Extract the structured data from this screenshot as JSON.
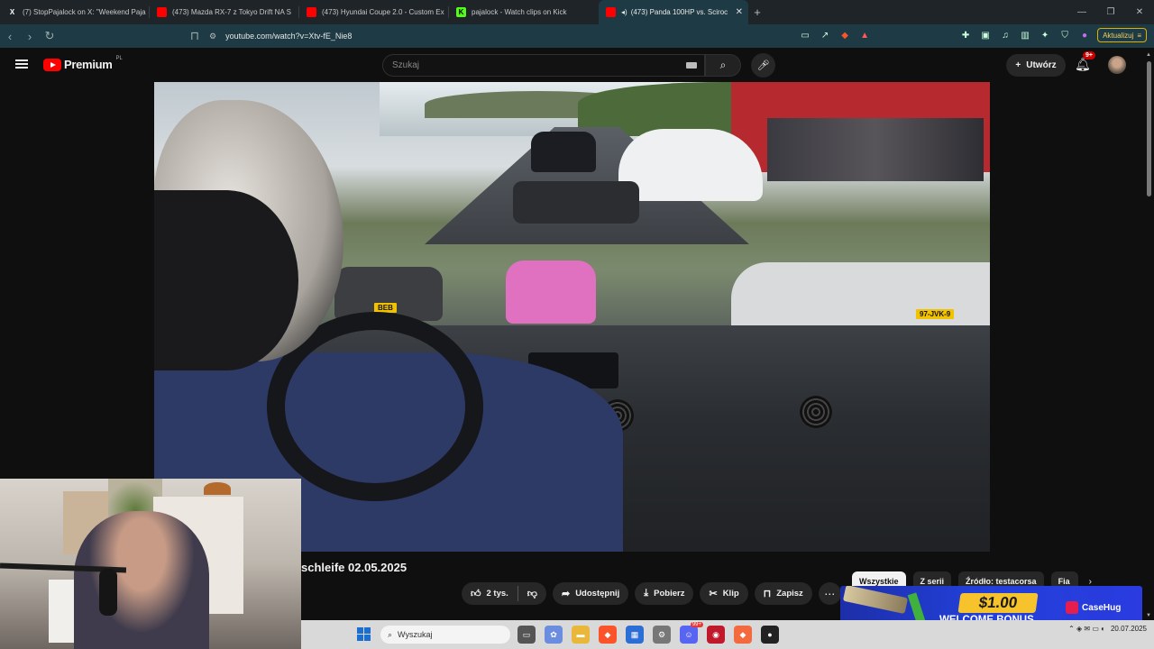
{
  "browser": {
    "tabs": [
      {
        "title": "(7) StopPajalock on X: \"Weekend Paja",
        "favicon": "x",
        "active": false
      },
      {
        "title": "(473) Mazda RX-7 z Tokyo Drift NA S",
        "favicon": "youtube",
        "active": false
      },
      {
        "title": "(473) Hyundai Coupe 2.0 - Custom Ex",
        "favicon": "youtube",
        "active": false
      },
      {
        "title": "pajalock - Watch clips on Kick",
        "favicon": "kick",
        "active": false
      },
      {
        "title": "(473) Panda 100HP vs. Sciroc",
        "favicon": "youtube",
        "active": true
      }
    ],
    "url": "youtube.com/watch?v=Xtv-fE_Nie8",
    "update_label": "Aktualizuj",
    "new_tab_glyph": "+"
  },
  "youtube": {
    "logo_text": "Premium",
    "country_code": "PL",
    "search_placeholder": "Szukaj",
    "create_label": "Utwórz",
    "notifications_badge": "9+",
    "video_title": "schleife 02.05.2025",
    "actions": {
      "likes": "2 tys.",
      "share": "Udostępnij",
      "download": "Pobierz",
      "clip": "Klip",
      "save": "Zapisz"
    },
    "chips": [
      "Wszystkie",
      "Z serii",
      "Źródło: testacorsa",
      "Fia"
    ],
    "plates": {
      "left": "BEB",
      "right": "97-JVK-9"
    }
  },
  "ad": {
    "amount": "$1.00",
    "bonus": "WELCOME BONUS",
    "brand": "CaseHug"
  },
  "taskbar": {
    "search_label": "Wyszukaj",
    "date": "20.07.2025",
    "chat_badge": "99+"
  },
  "colors": {
    "youtube_red": "#ff0000",
    "browser_bg": "#1e3a44",
    "page_bg": "#0f0f0f",
    "ad_yellow": "#f6c32c",
    "ad_blue": "#2240d8"
  }
}
